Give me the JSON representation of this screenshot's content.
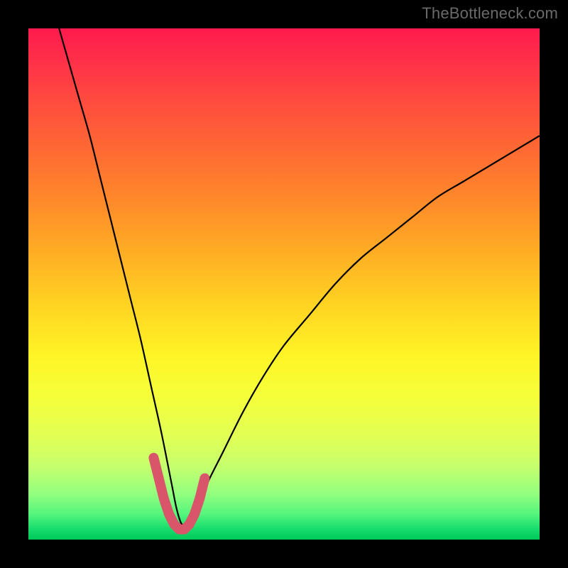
{
  "watermark": "TheBottleneck.com",
  "chart_data": {
    "type": "line",
    "title": "",
    "xlabel": "",
    "ylabel": "",
    "xlim": [
      0,
      100
    ],
    "ylim": [
      0,
      100
    ],
    "series": [
      {
        "name": "bottleneck-curve",
        "x": [
          6,
          8,
          10,
          12,
          14,
          16,
          18,
          20,
          22,
          24,
          26,
          28,
          29,
          30,
          31,
          33,
          35,
          38,
          42,
          46,
          50,
          55,
          60,
          65,
          70,
          75,
          80,
          85,
          90,
          95,
          100
        ],
        "y": [
          100,
          93,
          86,
          79,
          71,
          63,
          55,
          47,
          39,
          30,
          21,
          11,
          6,
          3,
          3,
          6,
          11,
          17,
          25,
          32,
          38,
          44,
          50,
          55,
          59,
          63,
          67,
          70,
          73,
          76,
          79
        ]
      },
      {
        "name": "bottleneck-zone",
        "x": [
          24.5,
          25.5,
          26.5,
          27.5,
          28.5,
          29.5,
          30.5,
          31.5,
          32.5,
          33.5,
          34.5
        ],
        "y": [
          16,
          12,
          8,
          5,
          3,
          2,
          2,
          3,
          5,
          8,
          12
        ]
      }
    ],
    "background_gradient": {
      "direction": "vertical",
      "stops": [
        {
          "color": "#ff1a4d",
          "pct": 0
        },
        {
          "color": "#ff6a33",
          "pct": 24
        },
        {
          "color": "#ffd322",
          "pct": 54
        },
        {
          "color": "#e1ff55",
          "pct": 80
        },
        {
          "color": "#00c85a",
          "pct": 100
        }
      ]
    }
  }
}
